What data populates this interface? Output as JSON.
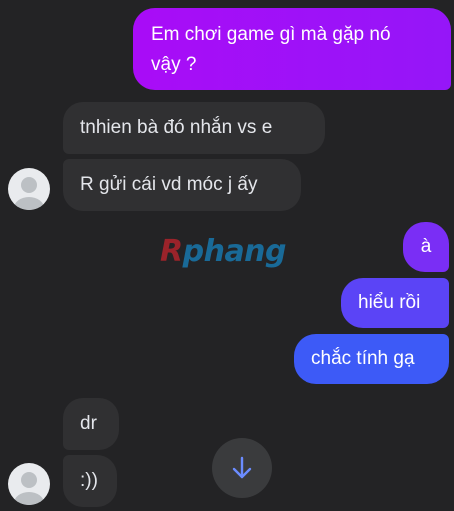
{
  "messages": [
    {
      "side": "out",
      "text": "Em chơi game gì mà gặp nó\nvậy ?"
    },
    {
      "side": "in",
      "text": "tnhien bà đó nhắn vs e"
    },
    {
      "side": "in",
      "text": "R gửi cái vd móc j ấy"
    },
    {
      "side": "out",
      "text": "à"
    },
    {
      "side": "out",
      "text": "hiểu rồi"
    },
    {
      "side": "out",
      "text": "chắc tính gạ"
    },
    {
      "side": "in",
      "text": "dr"
    },
    {
      "side": "in",
      "text": ":))"
    }
  ],
  "watermark": {
    "first_letter": "R",
    "rest": "phang"
  },
  "colors": {
    "background": "#232325",
    "incoming_bubble": "#303032",
    "outgoing_top": "#a90cf7",
    "outgoing_mid": "#7a2ef5",
    "outgoing_bottom": "#3d5af7",
    "scroll_arrow": "#6b8cff"
  },
  "scroll_button": {
    "icon": "arrow-down-icon"
  }
}
